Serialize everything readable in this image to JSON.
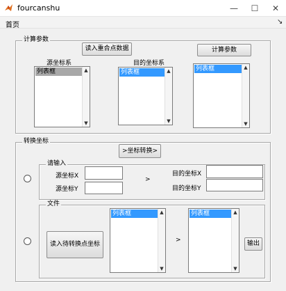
{
  "window": {
    "title": "fourcanshu",
    "minimize_icon": "minimize-icon",
    "maximize_icon": "maximize-icon",
    "close_icon": "close-icon"
  },
  "menu": {
    "items": [
      "首页"
    ],
    "dock_icon": "dock-arrow-icon"
  },
  "calc_panel": {
    "legend": "计算参数",
    "read_button": "读入重合点数据",
    "calc_button": "计算参数",
    "source_label": "源坐标系",
    "target_label": "目的坐标系",
    "source_list": [
      "列表框"
    ],
    "target_list": [
      "列表框"
    ],
    "param_list": [
      "列表框"
    ]
  },
  "convert_panel": {
    "legend": "转换坐标",
    "convert_button": ">坐标转换>",
    "input_group": {
      "legend": "请输入",
      "source_x_label": "源坐标X",
      "source_y_label": "源坐标Y",
      "target_x_label": "目的坐标X",
      "target_y_label": "目的坐标Y",
      "arrow": ">",
      "source_x_value": "",
      "source_y_value": "",
      "target_x_value": "",
      "target_y_value": ""
    },
    "file_group": {
      "legend": "文件",
      "read_button": "读入待转换点坐标",
      "input_list": [
        "列表框"
      ],
      "output_list": [
        "列表框"
      ],
      "arrow": ">",
      "output_button": "输出"
    }
  }
}
